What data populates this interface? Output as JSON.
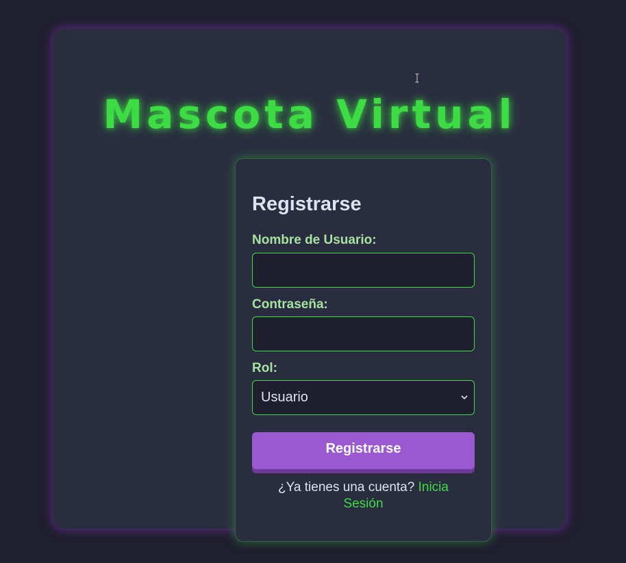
{
  "app": {
    "title": "Mascota Virtual"
  },
  "form": {
    "heading": "Registrarse",
    "username_label": "Nombre de Usuario:",
    "username_value": "",
    "password_label": "Contraseña:",
    "password_value": "",
    "role_label": "Rol:",
    "role_selected": "Usuario",
    "submit_label": "Registrarse",
    "footer_prompt": "¿Ya tienes una cuenta?",
    "login_link": "Inicia Sesión"
  },
  "icons": {
    "select_arrow": "chevron-down-icon",
    "cursor": "text-cursor-icon"
  },
  "colors": {
    "background": "#1f1f2e",
    "panel": "#2a2d3f",
    "accent_green": "#3ddc45",
    "label_green": "#a6e3a1",
    "button_purple": "#9b59d0",
    "panel_glow_purple": "#8c32c8",
    "text_light": "#dfe3f0",
    "input_bg": "#1e1e2e"
  }
}
